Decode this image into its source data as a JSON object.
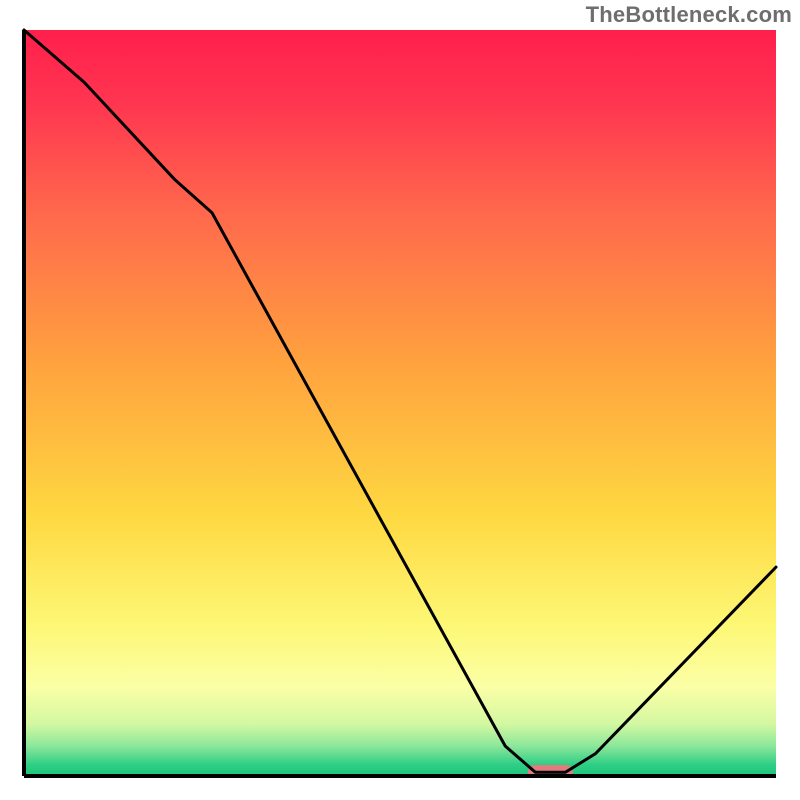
{
  "watermark": "TheBottleneck.com",
  "chart_data": {
    "type": "line",
    "title": "",
    "xlabel": "",
    "ylabel": "",
    "xlim": [
      0,
      100
    ],
    "ylim": [
      0,
      100
    ],
    "grid": false,
    "series": [
      {
        "name": "bottleneck-curve",
        "x": [
          0,
          8,
          20,
          25,
          64,
          68,
          72,
          76,
          100
        ],
        "values": [
          100,
          93,
          80,
          75.5,
          4,
          0.5,
          0.5,
          3,
          28
        ]
      }
    ],
    "marker": {
      "name": "optimal-range",
      "x_center": 70,
      "x_width": 6,
      "color": "#e27a7e"
    },
    "gradient_stops": [
      {
        "offset": 0.0,
        "color": "#ff1f4c"
      },
      {
        "offset": 0.1,
        "color": "#ff3650"
      },
      {
        "offset": 0.25,
        "color": "#ff6a4c"
      },
      {
        "offset": 0.45,
        "color": "#ffa33e"
      },
      {
        "offset": 0.65,
        "color": "#fed841"
      },
      {
        "offset": 0.8,
        "color": "#fdf876"
      },
      {
        "offset": 0.88,
        "color": "#fbffa6"
      },
      {
        "offset": 0.93,
        "color": "#d4f8a2"
      },
      {
        "offset": 0.96,
        "color": "#8be79a"
      },
      {
        "offset": 0.985,
        "color": "#2fce85"
      },
      {
        "offset": 1.0,
        "color": "#19c57c"
      }
    ],
    "axes_color": "#000000",
    "axes_width": 4,
    "curve_color": "#000000",
    "curve_width": 3
  }
}
